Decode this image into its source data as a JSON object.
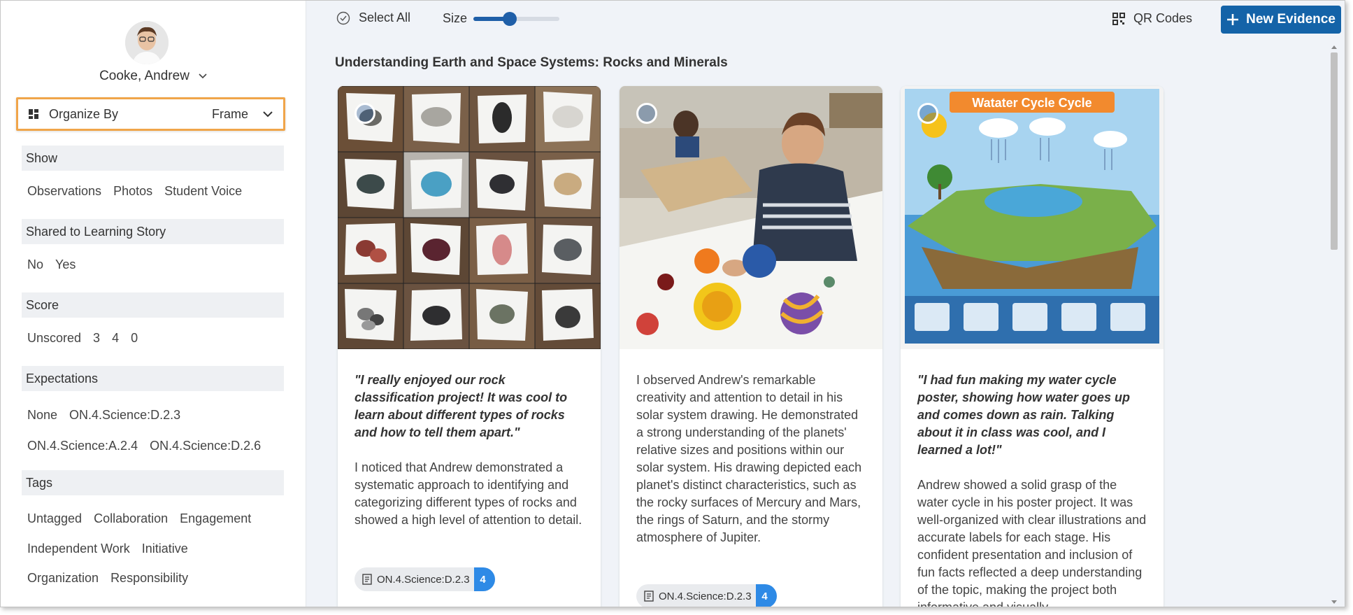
{
  "user": {
    "name": "Cooke, Andrew"
  },
  "organize": {
    "label": "Organize By",
    "value": "Frame"
  },
  "filters": {
    "show": {
      "title": "Show",
      "options": [
        "Observations",
        "Photos",
        "Student Voice"
      ]
    },
    "shared": {
      "title": "Shared to Learning Story",
      "options": [
        "No",
        "Yes"
      ]
    },
    "score": {
      "title": "Score",
      "options": [
        "Unscored",
        "3",
        "4",
        "0"
      ]
    },
    "expectations": {
      "title": "Expectations",
      "options": [
        "None",
        "ON.4.Science:D.2.3",
        "ON.4.Science:A.2.4",
        "ON.4.Science:D.2.6"
      ]
    },
    "tags": {
      "title": "Tags",
      "options": [
        "Untagged",
        "Collaboration",
        "Engagement",
        "Independent Work",
        "Initiative",
        "Organization",
        "Responsibility"
      ]
    }
  },
  "toolbar": {
    "select_all": "Select All",
    "size_label": "Size",
    "size_value": 0.42,
    "qr_codes": "QR Codes",
    "new_evidence": "New Evidence"
  },
  "section": {
    "title": "Understanding Earth and Space Systems: Rocks and Minerals"
  },
  "cards": [
    {
      "quote": "\"I really enjoyed our rock classification project! It was cool to learn about different types of rocks and how to tell them apart.\"",
      "body": "I noticed that Andrew demonstrated a systematic approach to identifying and categorizing different types of rocks and showed a high level of attention to detail.",
      "tag": "ON.4.Science:D.2.3",
      "tag_score": "4"
    },
    {
      "quote": "",
      "body": " I observed Andrew's remarkable creativity and attention to detail in his solar system drawing. He demonstrated a strong understanding of the planets' relative sizes and positions within our solar system. His drawing depicted each planet's distinct characteristics, such as the rocky surfaces of Mercury and Mars, the rings of Saturn, and the stormy atmosphere of Jupiter.",
      "tag": "ON.4.Science:D.2.3",
      "tag_score": "4"
    },
    {
      "quote": "\"I had fun making my water cycle poster, showing how water goes up and comes down as rain. Talking about it in class was cool, and I learned a lot!\"",
      "body": "Andrew showed a solid grasp of the water cycle in his poster project. It was well-organized with clear illustrations and accurate labels for each stage. His confident presentation and inclusion of fun facts reflected a deep understanding of the topic, making the project both informative and visually",
      "poster_title": "Watater Cycle Cycle"
    }
  ]
}
